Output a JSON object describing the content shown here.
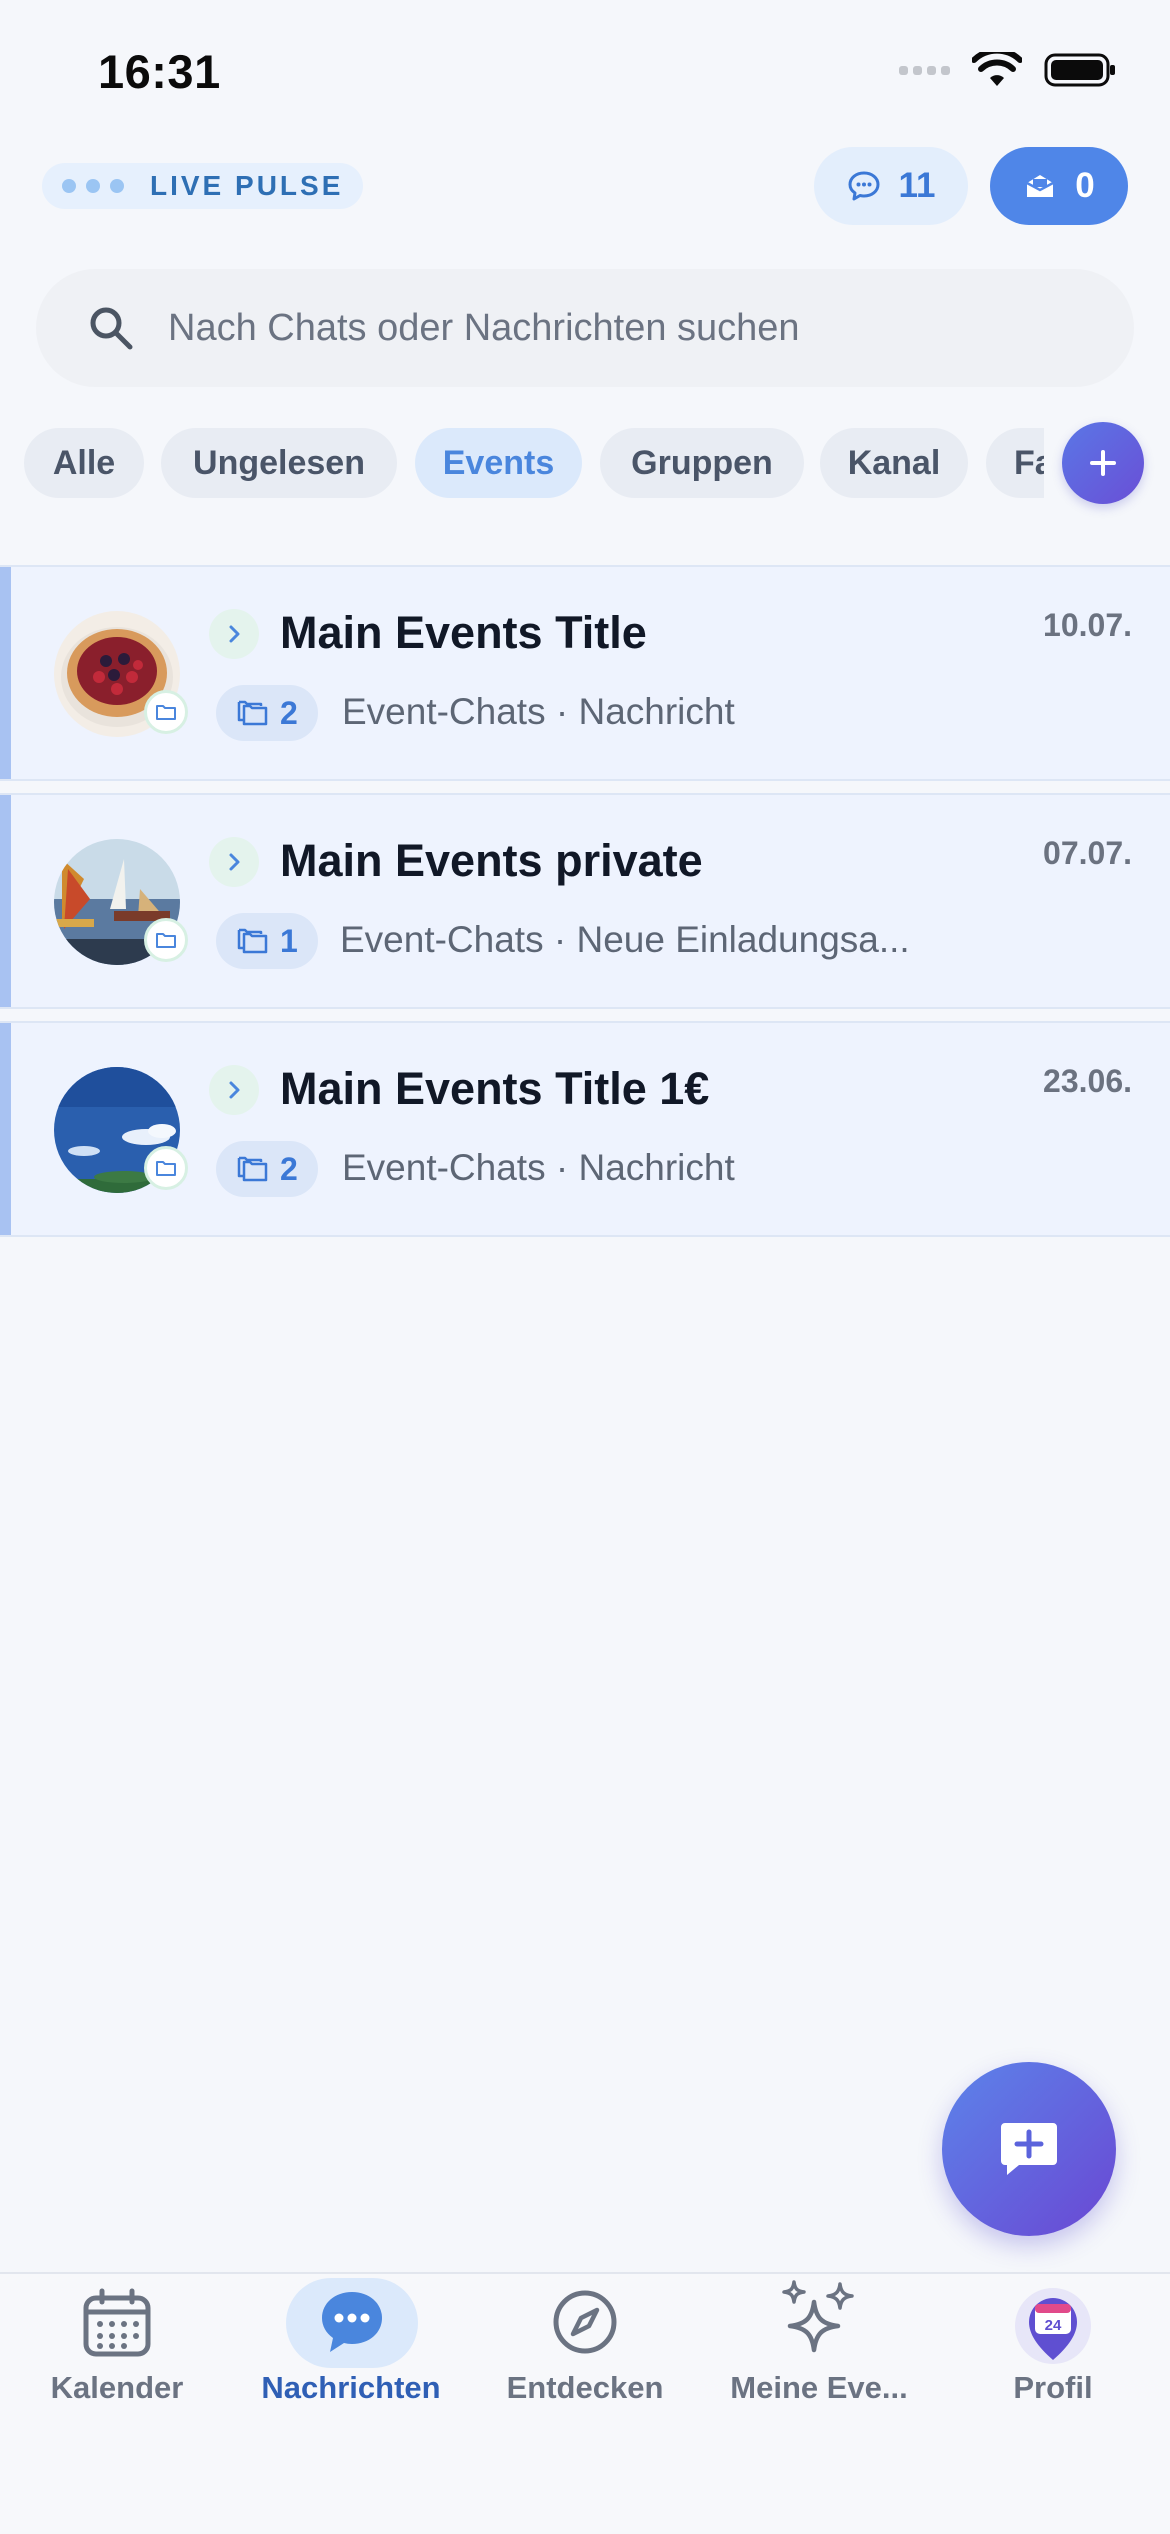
{
  "status_bar": {
    "time": "16:31"
  },
  "header": {
    "live_pulse_label": "LIVE PULSE",
    "chat_count": "11",
    "inbox_count": "0"
  },
  "search": {
    "placeholder": "Nach Chats oder Nachrichten suchen"
  },
  "filters": [
    "Alle",
    "Ungelesen",
    "Events",
    "Gruppen",
    "Kanal",
    "Fa"
  ],
  "active_filter": "Events",
  "chats": [
    {
      "title": "Main Events Title",
      "date": "10.07.",
      "count": "2",
      "preview": "Event-Chats · Nachricht",
      "avatar": "fruit-tart"
    },
    {
      "title": "Main Events private",
      "date": "07.07.",
      "count": "1",
      "preview": "Event-Chats · Neue Einladungsa...",
      "avatar": "sailboats-painting"
    },
    {
      "title": "Main Events Title 1€",
      "date": "23.06.",
      "count": "2",
      "preview": "Event-Chats · Nachricht",
      "avatar": "blue-sky"
    }
  ],
  "tabbar": {
    "items": [
      {
        "label": "Kalender",
        "icon": "calendar-icon"
      },
      {
        "label": "Nachrichten",
        "icon": "chat-bubble-icon"
      },
      {
        "label": "Entdecken",
        "icon": "compass-icon"
      },
      {
        "label": "Meine Eve...",
        "icon": "sparkles-icon"
      },
      {
        "label": "Profil",
        "icon": "profile-calendar-icon"
      }
    ],
    "active": "Nachrichten",
    "profile_badge": "24"
  },
  "colors": {
    "accent": "#4f86e8",
    "purple": "#6a47d3",
    "row_background": "#eef3fe"
  }
}
